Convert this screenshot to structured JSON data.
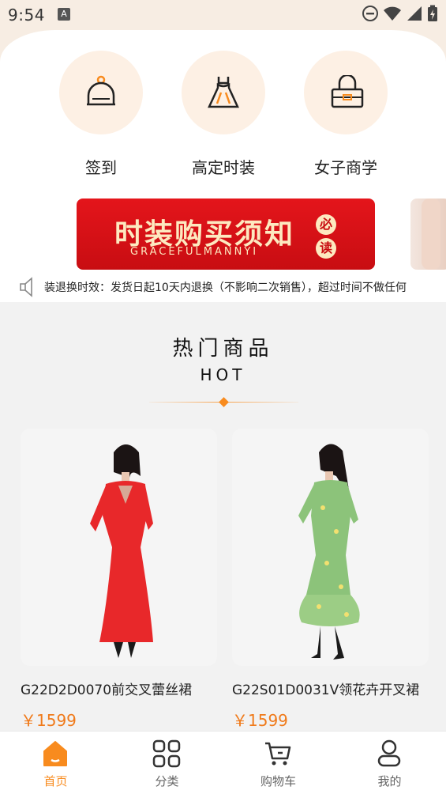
{
  "status_bar": {
    "time": "9:54",
    "notification_icon": "A"
  },
  "quick_entries": [
    {
      "label": "签到",
      "icon": "bell-icon"
    },
    {
      "label": "高定时装",
      "icon": "dress-icon"
    },
    {
      "label": "女子商学",
      "icon": "handbag-icon"
    }
  ],
  "banner": {
    "title": "时装购买须知",
    "subtitle": "GRACEFULMANNYI",
    "badge_top": "必",
    "badge_bottom": "读"
  },
  "notice": {
    "icon": "speaker-icon",
    "text": "装退换时效：发货日起10天内退换（不影响二次销售），超过时间不做任何"
  },
  "hot_section": {
    "title": "热门商品",
    "subtitle": "HOT"
  },
  "products": [
    {
      "name": "G22D2D0070前交叉蕾丝裙",
      "price": "￥1599",
      "dress_color": "#e8282a"
    },
    {
      "name": "G22S01D0031V领花卉开叉裙",
      "price": "￥1599",
      "dress_color": "#8cc37a"
    }
  ],
  "tabs": [
    {
      "label": "首页",
      "icon": "home-icon",
      "active": true
    },
    {
      "label": "分类",
      "icon": "grid-icon",
      "active": false
    },
    {
      "label": "购物车",
      "icon": "cart-icon",
      "active": false
    },
    {
      "label": "我的",
      "icon": "user-icon",
      "active": false
    }
  ],
  "colors": {
    "accent": "#f88b1e",
    "price": "#f07a1a",
    "banner_red": "#e4151b"
  }
}
